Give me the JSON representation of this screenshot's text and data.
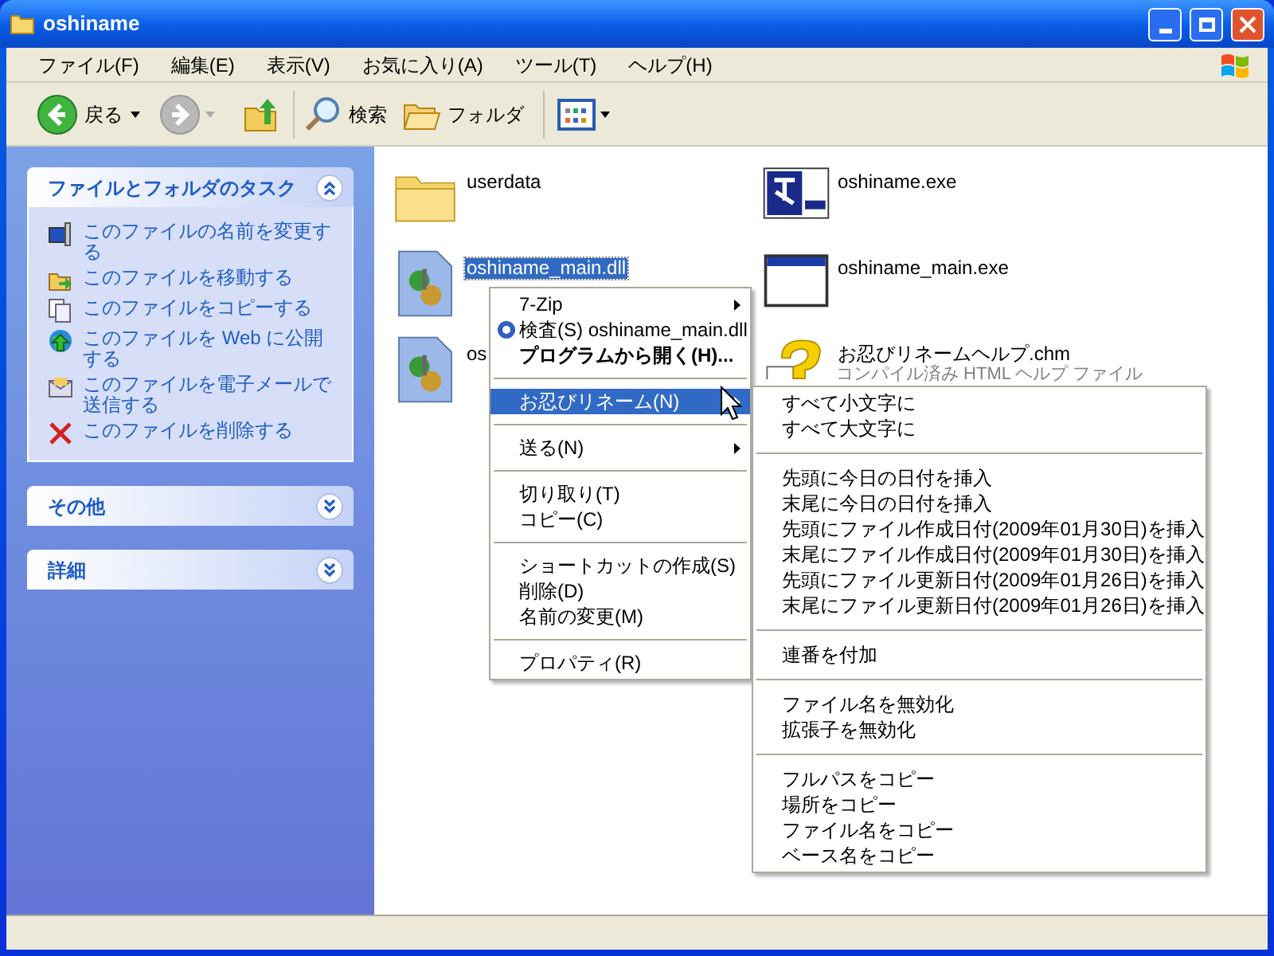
{
  "window": {
    "title": "oshiname"
  },
  "menu_bar": [
    "ファイル(F)",
    "編集(E)",
    "表示(V)",
    "お気に入り(A)",
    "ツール(T)",
    "ヘルプ(H)"
  ],
  "toolbar": {
    "back": "戻る",
    "search": "検索",
    "folders": "フォルダ"
  },
  "task_panels": [
    {
      "title": "ファイルとフォルダのタスク",
      "expanded": true,
      "links": [
        {
          "label": "このファイルの名前を変更する"
        },
        {
          "label": "このファイルを移動する"
        },
        {
          "label": "このファイルをコピーする"
        },
        {
          "label": "このファイルを Web に公開する"
        },
        {
          "label": "このファイルを電子メールで送信する"
        },
        {
          "label": "このファイルを削除する"
        }
      ]
    },
    {
      "title": "その他",
      "expanded": false
    },
    {
      "title": "詳細",
      "expanded": false
    }
  ],
  "files": [
    {
      "kind": "folder",
      "name": "userdata",
      "selected": false
    },
    {
      "kind": "app",
      "name": "oshiname.exe",
      "selected": false
    },
    {
      "kind": "library",
      "name": "oshiname_main.dll",
      "selected": true
    },
    {
      "kind": "window",
      "name": "oshiname_main.exe",
      "selected": false
    },
    {
      "kind": "library",
      "name": "os",
      "selected": false
    },
    {
      "kind": "help",
      "name": "お忍びリネームヘルプ.chm",
      "detail": "コンパイル済み HTML ヘルプ ファイル",
      "selected": false
    }
  ],
  "context_menu": [
    {
      "kind": "item",
      "label": "7-Zip",
      "submenu": true,
      "selected": false
    },
    {
      "kind": "scan",
      "label": "検査(S) oshiname_main.dll",
      "selected": false
    },
    {
      "kind": "item",
      "label": "プログラムから開く(H)...",
      "bold": true,
      "selected": false
    },
    {
      "kind": "separator"
    },
    {
      "kind": "item",
      "label": "お忍びリネーム(N)",
      "submenu": true,
      "selected": true
    },
    {
      "kind": "separator"
    },
    {
      "kind": "item",
      "label": "送る(N)",
      "submenu": true,
      "selected": false
    },
    {
      "kind": "separator"
    },
    {
      "kind": "item",
      "label": "切り取り(T)",
      "selected": false
    },
    {
      "kind": "item",
      "label": "コピー(C)",
      "selected": false
    },
    {
      "kind": "separator"
    },
    {
      "kind": "item",
      "label": "ショートカットの作成(S)",
      "selected": false
    },
    {
      "kind": "item",
      "label": "削除(D)",
      "selected": false
    },
    {
      "kind": "item",
      "label": "名前の変更(M)",
      "selected": false
    },
    {
      "kind": "separator"
    },
    {
      "kind": "item",
      "label": "プロパティ(R)",
      "selected": false
    }
  ],
  "submenu": [
    {
      "kind": "item",
      "label": "すべて小文字に"
    },
    {
      "kind": "item",
      "label": "すべて大文字に"
    },
    {
      "kind": "separator"
    },
    {
      "kind": "item",
      "label": "先頭に今日の日付を挿入"
    },
    {
      "kind": "item",
      "label": "末尾に今日の日付を挿入"
    },
    {
      "kind": "item",
      "label": "先頭にファイル作成日付(2009年01月30日)を挿入"
    },
    {
      "kind": "item",
      "label": "末尾にファイル作成日付(2009年01月30日)を挿入"
    },
    {
      "kind": "item",
      "label": "先頭にファイル更新日付(2009年01月26日)を挿入"
    },
    {
      "kind": "item",
      "label": "末尾にファイル更新日付(2009年01月26日)を挿入"
    },
    {
      "kind": "separator"
    },
    {
      "kind": "item",
      "label": "連番を付加"
    },
    {
      "kind": "separator"
    },
    {
      "kind": "item",
      "label": "ファイル名を無効化"
    },
    {
      "kind": "item",
      "label": "拡張子を無効化"
    },
    {
      "kind": "separator"
    },
    {
      "kind": "item",
      "label": "フルパスをコピー"
    },
    {
      "kind": "item",
      "label": "場所をコピー"
    },
    {
      "kind": "item",
      "label": "ファイル名をコピー"
    },
    {
      "kind": "item",
      "label": "ベース名をコピー"
    }
  ]
}
